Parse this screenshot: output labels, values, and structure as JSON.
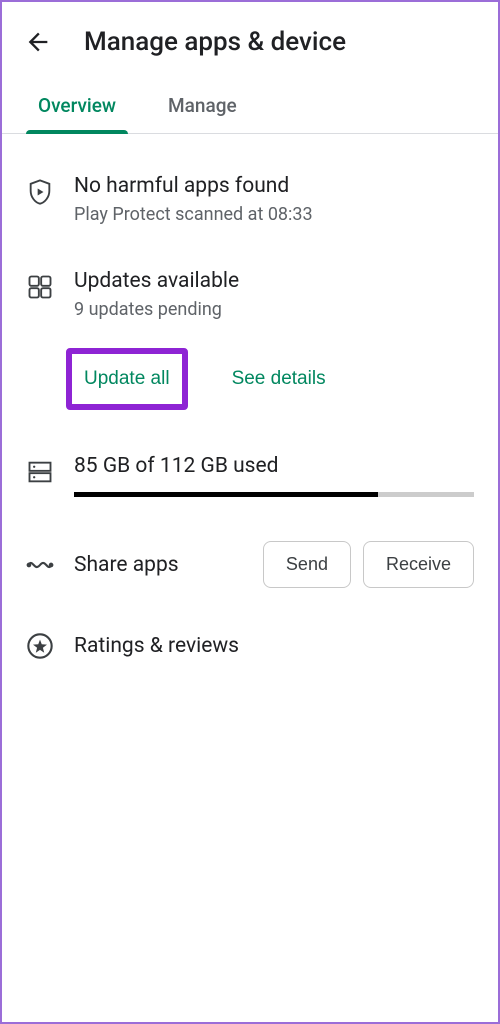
{
  "header": {
    "title": "Manage apps & device"
  },
  "tabs": {
    "overview": "Overview",
    "manage": "Manage"
  },
  "play_protect": {
    "title": "No harmful apps found",
    "subtitle": "Play Protect scanned at 08:33"
  },
  "updates": {
    "title": "Updates available",
    "subtitle": "9 updates pending",
    "update_all": "Update all",
    "see_details": "See details"
  },
  "storage": {
    "title": "85 GB of 112 GB used",
    "used": 85,
    "total": 112,
    "percent": 76
  },
  "share": {
    "title": "Share apps",
    "send": "Send",
    "receive": "Receive"
  },
  "ratings": {
    "title": "Ratings & reviews"
  }
}
